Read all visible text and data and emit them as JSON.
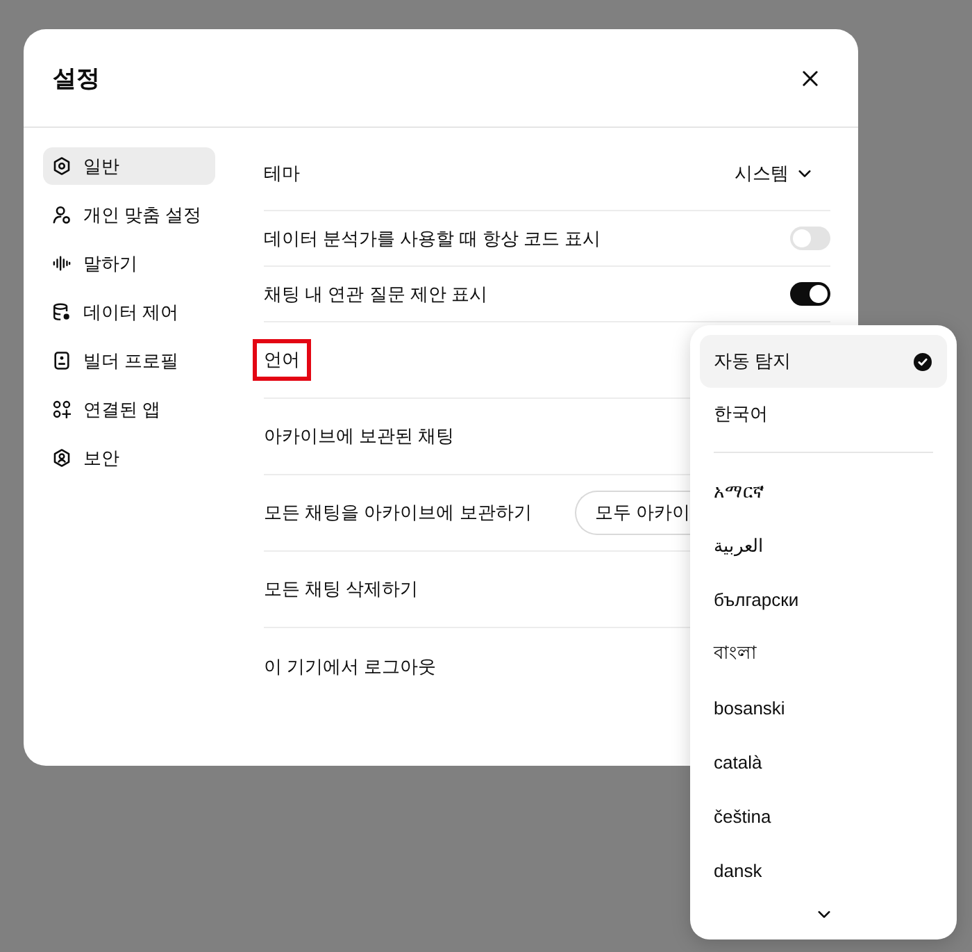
{
  "dialog": {
    "title": "설정"
  },
  "sidebar": {
    "items": [
      {
        "label": "일반",
        "selected": true
      },
      {
        "label": "개인 맞춤 설정",
        "selected": false
      },
      {
        "label": "말하기",
        "selected": false
      },
      {
        "label": "데이터 제어",
        "selected": false
      },
      {
        "label": "빌더 프로필",
        "selected": false
      },
      {
        "label": "연결된 앱",
        "selected": false
      },
      {
        "label": "보안",
        "selected": false
      }
    ]
  },
  "settings": {
    "rows": [
      {
        "kind": "select",
        "label": "테마",
        "value": "시스템",
        "highlighted": false
      },
      {
        "kind": "toggle",
        "label": "데이터 분석가를 사용할 때 항상 코드 표시",
        "on": false,
        "highlighted": false
      },
      {
        "kind": "toggle",
        "label": "채팅 내 연관 질문 제안 표시",
        "on": true,
        "highlighted": false
      },
      {
        "kind": "plain",
        "label": "언어",
        "highlighted": true
      },
      {
        "kind": "plain",
        "label": "아카이브에 보관된 채팅",
        "highlighted": false
      },
      {
        "kind": "button",
        "label": "모든 채팅을 아카이브에 보관하기",
        "button": "모두 아카이",
        "highlighted": false
      },
      {
        "kind": "plain",
        "label": "모든 채팅 삭제하기",
        "highlighted": false
      },
      {
        "kind": "plain",
        "label": "이 기기에서 로그아웃",
        "highlighted": false
      }
    ]
  },
  "language_menu": {
    "sections": [
      {
        "items": [
          {
            "label": "자동 탐지",
            "selected": true
          },
          {
            "label": "한국어",
            "selected": false
          }
        ]
      },
      {
        "items": [
          {
            "label": "አማርኛ",
            "selected": false
          },
          {
            "label": "العربية",
            "selected": false
          },
          {
            "label": "български",
            "selected": false
          },
          {
            "label": "বাংলা",
            "selected": false
          },
          {
            "label": "bosanski",
            "selected": false
          },
          {
            "label": "català",
            "selected": false
          },
          {
            "label": "čeština",
            "selected": false
          },
          {
            "label": "dansk",
            "selected": false
          }
        ]
      }
    ]
  }
}
